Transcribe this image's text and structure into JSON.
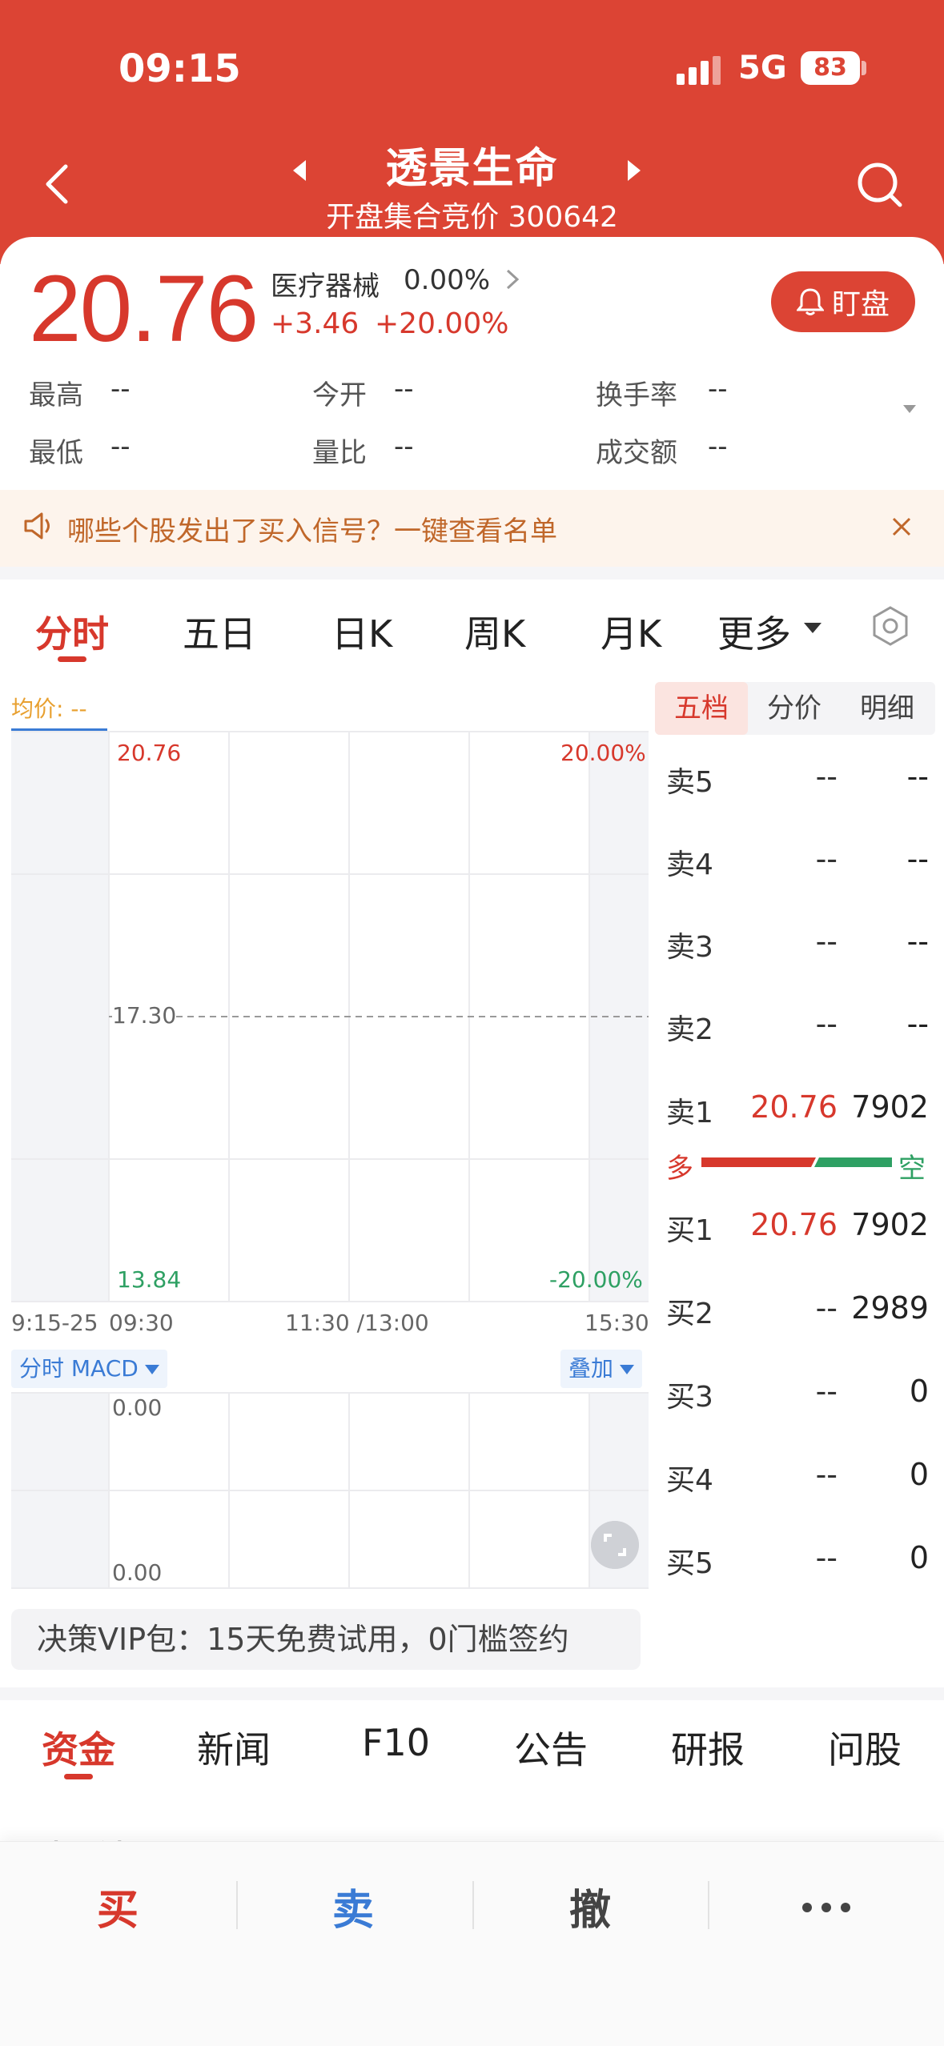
{
  "status_bar": {
    "time": "09:15",
    "network": "5G",
    "battery": "83"
  },
  "header": {
    "stock_name": "透景生命",
    "subtitle": "开盘集合竞价 300642"
  },
  "quote": {
    "price": "20.76",
    "industry": "医疗器械",
    "industry_change": "0.00%",
    "change": "+3.46",
    "change_pct": "+20.00%",
    "watch_button": "盯盘"
  },
  "stats": [
    {
      "label": "最高",
      "value": "--"
    },
    {
      "label": "今开",
      "value": "--"
    },
    {
      "label": "换手率",
      "value": "--"
    },
    {
      "label": "最低",
      "value": "--"
    },
    {
      "label": "量比",
      "value": "--"
    },
    {
      "label": "成交额",
      "value": "--"
    }
  ],
  "banner": {
    "text": "哪些个股发出了买入信号？一键查看名单"
  },
  "chart_tabs": [
    "分时",
    "五日",
    "日K",
    "周K",
    "月K",
    "更多"
  ],
  "chart": {
    "avg_label": "均价: --",
    "y_top": "20.76",
    "y_mid": "17.30",
    "y_bottom": "13.84",
    "pct_top": "20.00%",
    "pct_bottom": "-20.00%",
    "time_labels": [
      "9:15-25",
      "09:30",
      "11:30 /13:00",
      "15:30"
    ],
    "macd_label": "分时 MACD",
    "overlay_label": "叠加",
    "macd_top": "0.00",
    "macd_bottom": "0.00",
    "colors": {
      "up": "#d7382c",
      "down": "#2ea063",
      "avg": "#e8a030"
    }
  },
  "vip": {
    "text": "决策VIP包：15天免费试用，0门槛签约"
  },
  "orderbook": {
    "tabs": [
      "五档",
      "分价",
      "明细"
    ],
    "asks": [
      {
        "label": "卖5",
        "price": "--",
        "volume": "--"
      },
      {
        "label": "卖4",
        "price": "--",
        "volume": "--"
      },
      {
        "label": "卖3",
        "price": "--",
        "volume": "--"
      },
      {
        "label": "卖2",
        "price": "--",
        "volume": "--"
      },
      {
        "label": "卖1",
        "price": "20.76",
        "volume": "7902"
      }
    ],
    "long_label": "多",
    "short_label": "空",
    "long_ratio": 0.6,
    "bids": [
      {
        "label": "买1",
        "price": "20.76",
        "volume": "7902"
      },
      {
        "label": "买2",
        "price": "--",
        "volume": "2989"
      },
      {
        "label": "买3",
        "price": "--",
        "volume": "0"
      },
      {
        "label": "买4",
        "price": "--",
        "volume": "0"
      },
      {
        "label": "买5",
        "price": "--",
        "volume": "0"
      }
    ]
  },
  "bottom_tabs": [
    "资金",
    "新闻",
    "F10",
    "公告",
    "研报",
    "问股"
  ],
  "section_peek": "相关板块",
  "tradebar": {
    "buy": "买",
    "sell": "卖",
    "cancel": "撤"
  }
}
